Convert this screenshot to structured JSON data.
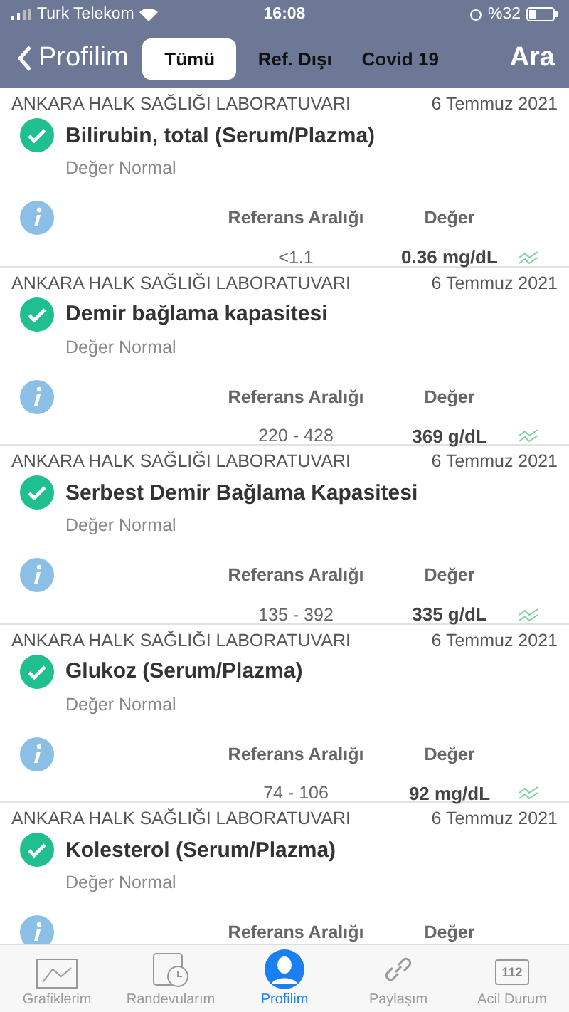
{
  "status_bar": {
    "carrier": "Turk Telekom",
    "time": "16:08",
    "battery": "%32"
  },
  "nav": {
    "back": "Profilim",
    "segments": [
      {
        "label": "Tümü",
        "selected": true
      },
      {
        "label": "Ref. Dışı",
        "selected": false
      },
      {
        "label": "Covid 19",
        "selected": false
      }
    ],
    "action": "Ara"
  },
  "results": [
    {
      "lab": "ANKARA HALK SAĞLIĞI LABORATUVARI",
      "date": "6 Temmuz 2021",
      "test": "Bilirubin, total (Serum/Plazma)",
      "status": "Değer Normal",
      "reference_header": "Referans Aralığı",
      "value_header": "Değer",
      "reference": "<1.1",
      "value": "0.36 mg/dL"
    },
    {
      "lab": "ANKARA HALK SAĞLIĞI LABORATUVARI",
      "date": "6 Temmuz 2021",
      "test": "Demir bağlama kapasitesi",
      "status": "Değer Normal",
      "reference_header": "Referans Aralığı",
      "value_header": "Değer",
      "reference": "220 - 428",
      "value": "369 g/dL"
    },
    {
      "lab": "ANKARA HALK SAĞLIĞI LABORATUVARI",
      "date": "6 Temmuz 2021",
      "test": "Serbest Demir Bağlama Kapasitesi",
      "status": "Değer Normal",
      "reference_header": "Referans Aralığı",
      "value_header": "Değer",
      "reference": "135 - 392",
      "value": "335 g/dL"
    },
    {
      "lab": "ANKARA HALK SAĞLIĞI LABORATUVARI",
      "date": "6 Temmuz 2021",
      "test": "Glukoz (Serum/Plazma)",
      "status": "Değer Normal",
      "reference_header": "Referans Aralığı",
      "value_header": "Değer",
      "reference": "74 - 106",
      "value": "92 mg/dL"
    },
    {
      "lab": "ANKARA HALK SAĞLIĞI LABORATUVARI",
      "date": "6 Temmuz 2021",
      "test": "Kolesterol (Serum/Plazma)",
      "status": "Değer Normal",
      "reference_header": "Referans Aralığı",
      "value_header": "Değer"
    }
  ],
  "tab_bar": [
    {
      "kind": "chart",
      "label": "Grafiklerim",
      "selected": false
    },
    {
      "kind": "calendar",
      "label": "Randevularım",
      "selected": false
    },
    {
      "kind": "profile",
      "label": "Profilim",
      "selected": true
    },
    {
      "kind": "link",
      "label": "Paylaşım",
      "selected": false
    },
    {
      "kind": "emergency",
      "label": "Acil Durum",
      "icon_text": "112",
      "selected": false
    }
  ]
}
